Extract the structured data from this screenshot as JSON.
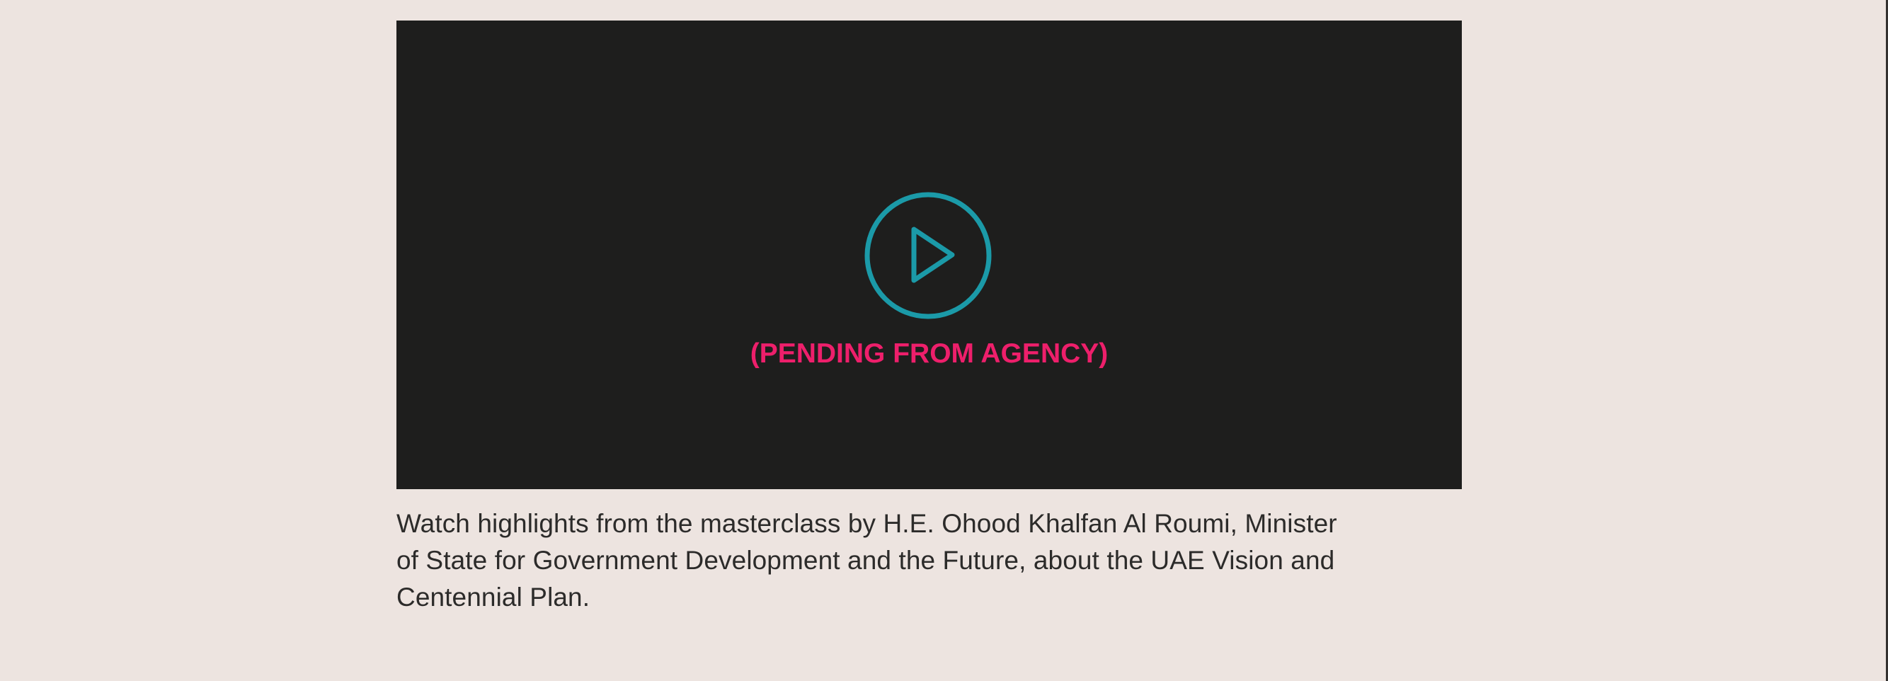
{
  "video": {
    "overlay_label": "(PENDING FROM AGENCY)",
    "play_icon": "play-circle-icon",
    "background_color": "#1e1e1d",
    "icon_color": "#1b9aa8",
    "label_color": "#ee1f6b"
  },
  "caption": {
    "line1": "Watch highlights from the masterclass by H.E. Ohood Khalfan Al Roumi, Minister",
    "line2": "of State for Government Development and the Future, about the UAE Vision and",
    "line3": "Centennial Plan."
  },
  "page": {
    "background_color": "#ede4e0"
  }
}
